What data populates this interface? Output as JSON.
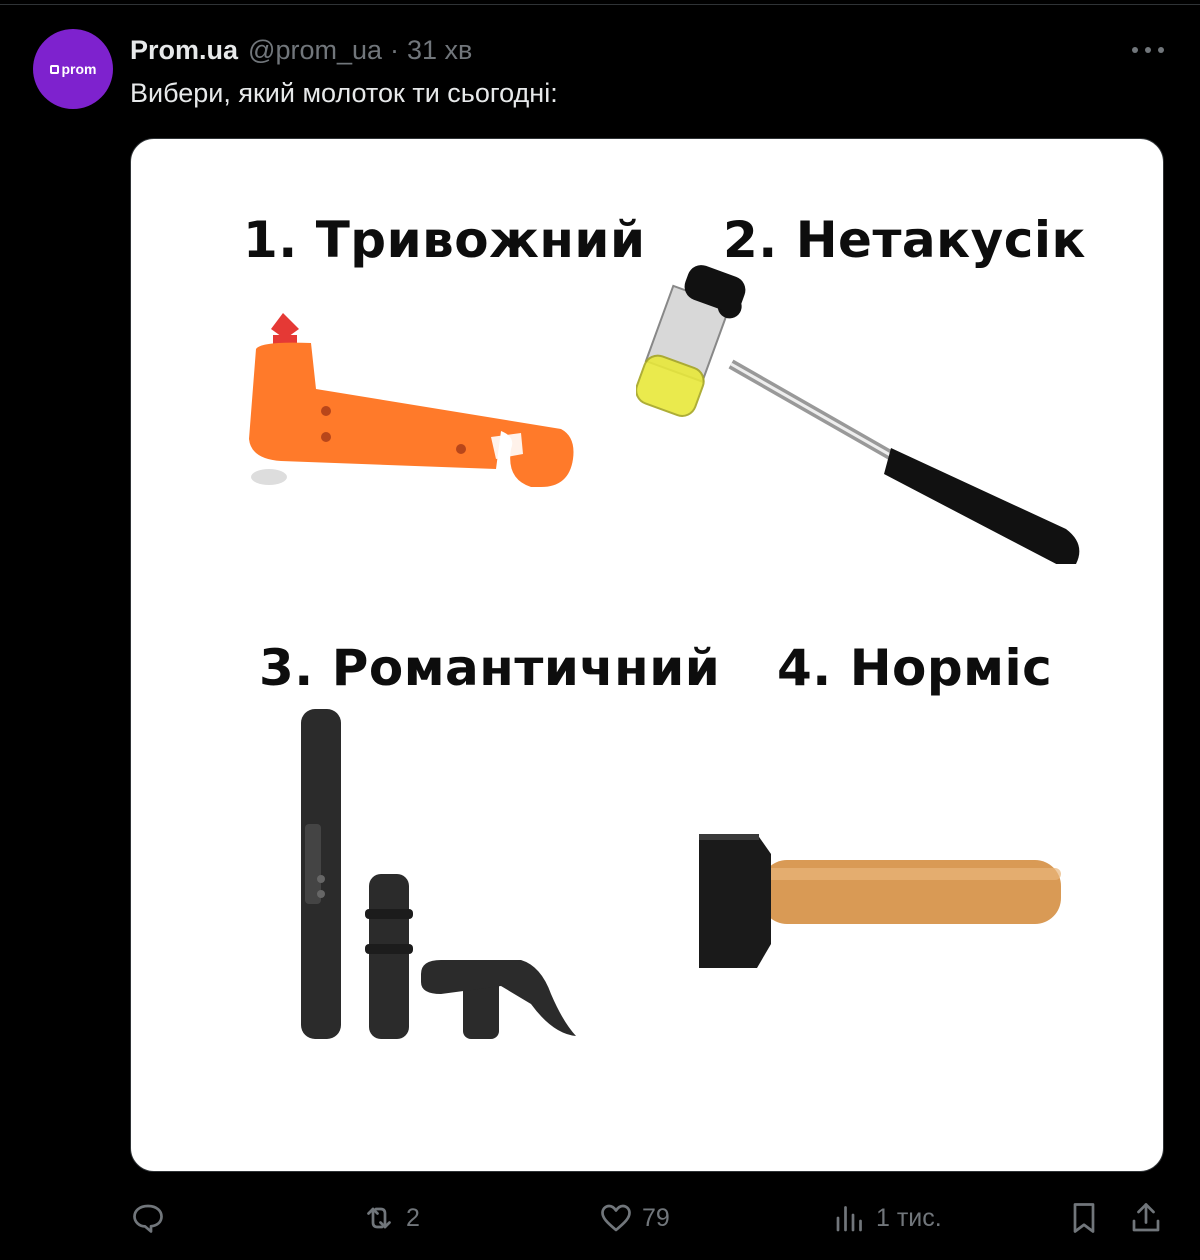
{
  "tweet": {
    "author_name": "Prom.ua",
    "handle": "@prom_ua",
    "separator": "·",
    "time": "31 хв",
    "avatar_text": "prom",
    "text": "Вибери, який молоток ти сьогодні:"
  },
  "media": {
    "items": [
      {
        "label": "1. Тривожний"
      },
      {
        "label": "2. Нетакусік"
      },
      {
        "label": "3. Романтичний"
      },
      {
        "label": "4. Нормiс"
      }
    ]
  },
  "actions": {
    "replies": "",
    "reposts": "2",
    "likes": "79",
    "views": "1 тис."
  },
  "icons": {
    "reply": "reply-icon",
    "repost": "repost-icon",
    "like": "heart-icon",
    "views": "views-icon",
    "bookmark": "bookmark-icon",
    "share": "share-icon",
    "more": "more-icon"
  },
  "colors": {
    "background": "#000000",
    "text": "#e7e9ea",
    "muted": "#71767b",
    "avatar": "#7e22ce"
  }
}
